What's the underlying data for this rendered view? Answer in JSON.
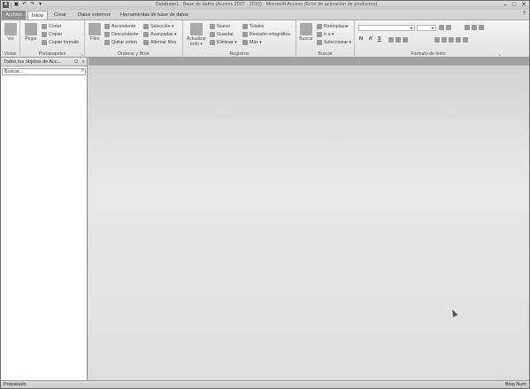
{
  "window": {
    "title": "Database1 : Base de datos (Access 2007 - 2010) - Microsoft Access (Error de activación de productos)",
    "app_icon": "A",
    "controls": [
      "–",
      "□",
      "✕"
    ]
  },
  "qat": {
    "items": [
      "save-icon",
      "undo-icon",
      "redo-icon",
      "customize-icon"
    ]
  },
  "tabs": {
    "file": "Archivo",
    "items": [
      "Inicio",
      "Crear",
      "Datos externos",
      "Herramientas de base de datos"
    ],
    "active": "Inicio",
    "help": "?"
  },
  "ribbon": {
    "vistas": {
      "label": "Vistas",
      "view_button": "Ver"
    },
    "portapapeles": {
      "label": "Portapapeles",
      "paste": "Pegar",
      "cut": "Cortar",
      "copy": "Copiar",
      "format_painter": "Copiar formato"
    },
    "ordenar": {
      "label": "Ordenar y filtrar",
      "filter": "Filtro",
      "asc": "Ascendente",
      "desc": "Descendente",
      "remove_sort": "Quitar orden",
      "selection": "Selección ▾",
      "advanced": "Avanzadas ▾",
      "toggle_filter": "Alternar filtro"
    },
    "registros": {
      "label": "Registros",
      "refresh": "Actualizar todo ▾",
      "new": "Nuevo",
      "save": "Guardar",
      "delete": "Eliminar ▾",
      "totals": "Totales",
      "spelling": "Revisión ortográfica",
      "more": "Más ▾"
    },
    "buscar": {
      "label": "Buscar",
      "find": "Buscar",
      "replace": "Reemplazar",
      "goto": "Ir a ▾",
      "select": "Seleccionar ▾"
    },
    "formato": {
      "label": "Formato de texto",
      "bold": "N",
      "italic": "K",
      "underline": "S"
    }
  },
  "nav_pane": {
    "title": "Todos los objetos de Acc...",
    "search_placeholder": "Buscar..."
  },
  "status_bar": {
    "left": "Preparado",
    "right": "Bloq Num"
  }
}
